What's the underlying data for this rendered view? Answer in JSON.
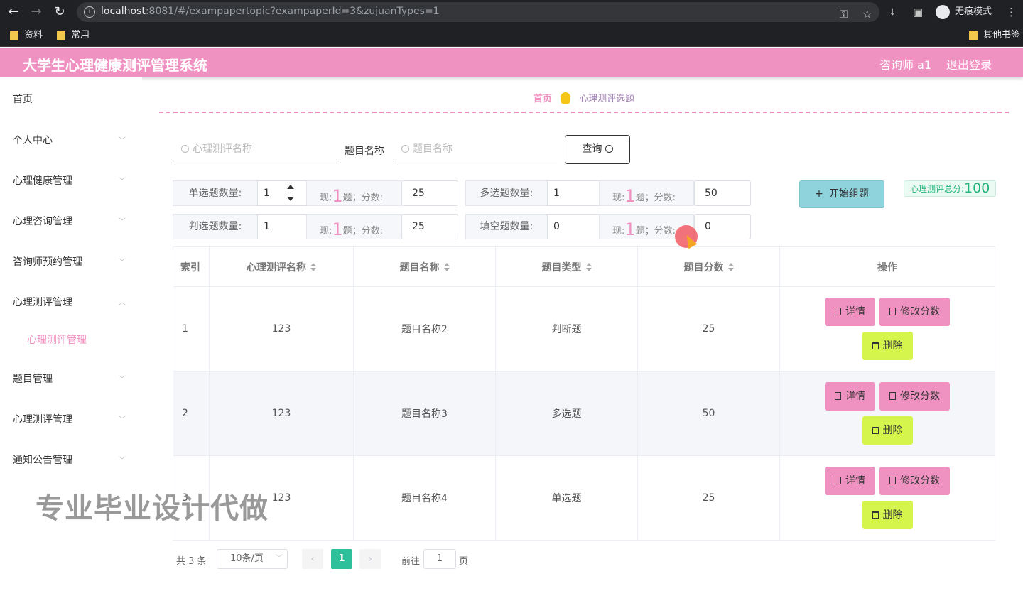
{
  "browser": {
    "url_host": "localhost",
    "url_rest": ":8081/#/exampapertopic?exampaperId=3&zujuanTypes=1",
    "incognito_label": "无痕模式",
    "bookmarks": [
      "资料",
      "常用"
    ],
    "other_bookmarks": "其他书签"
  },
  "header": {
    "title": "大学生心理健康测评管理系统",
    "user": "咨询师 a1",
    "logout": "退出登录"
  },
  "sidebar": {
    "items": [
      {
        "label": "首页"
      },
      {
        "label": "个人中心"
      },
      {
        "label": "心理健康管理"
      },
      {
        "label": "心理咨询管理"
      },
      {
        "label": "咨询师预约管理"
      },
      {
        "label": "心理测评管理"
      },
      {
        "label": "题目管理"
      },
      {
        "label": "心理测评管理"
      },
      {
        "label": "通知公告管理"
      }
    ],
    "active_sub": "心理测评管理"
  },
  "breadcrumb": {
    "home": "首页",
    "current": "心理测评选题"
  },
  "search": {
    "name_placeholder": "心理测评名称",
    "title_label": "题目名称",
    "title_placeholder": "题目名称",
    "query_button": "查询"
  },
  "config": {
    "single": {
      "label": "单选题数量:",
      "count": "1",
      "now_prefix": "现:",
      "now": "1",
      "now_suffix": "题；分数:",
      "score": "25"
    },
    "multi": {
      "label": "多选题数量:",
      "count": "1",
      "now_prefix": "现:",
      "now": "1",
      "now_suffix": "题；分数:",
      "score": "50"
    },
    "judge": {
      "label": "判选题数量:",
      "count": "1",
      "now_prefix": "现:",
      "now": "1",
      "now_suffix": "题；分数:",
      "score": "25"
    },
    "fill": {
      "label": "填空题数量:",
      "count": "0",
      "now_prefix": "现:",
      "now": "1",
      "now_suffix": "题；分数:",
      "score": "0"
    },
    "start_button": "开始组题",
    "total_label": "心理测评总分:",
    "total_value": "100"
  },
  "table": {
    "headers": [
      "索引",
      "心理测评名称",
      "题目名称",
      "题目类型",
      "题目分数",
      "操作"
    ],
    "rows": [
      {
        "index": "1",
        "name": "123",
        "title": "题目名称2",
        "type": "判断题",
        "score": "25"
      },
      {
        "index": "2",
        "name": "123",
        "title": "题目名称3",
        "type": "多选题",
        "score": "50"
      },
      {
        "index": "3",
        "name": "123",
        "title": "题目名称4",
        "type": "单选题",
        "score": "25"
      }
    ],
    "actions": {
      "detail": "详情",
      "edit_score": "修改分数",
      "delete": "删除"
    }
  },
  "pagination": {
    "total": "共 3 条",
    "page_size": "10条/页",
    "current": "1",
    "goto_prefix": "前往",
    "goto_value": "1",
    "goto_suffix": "页"
  },
  "watermark": "专业毕业设计代做"
}
